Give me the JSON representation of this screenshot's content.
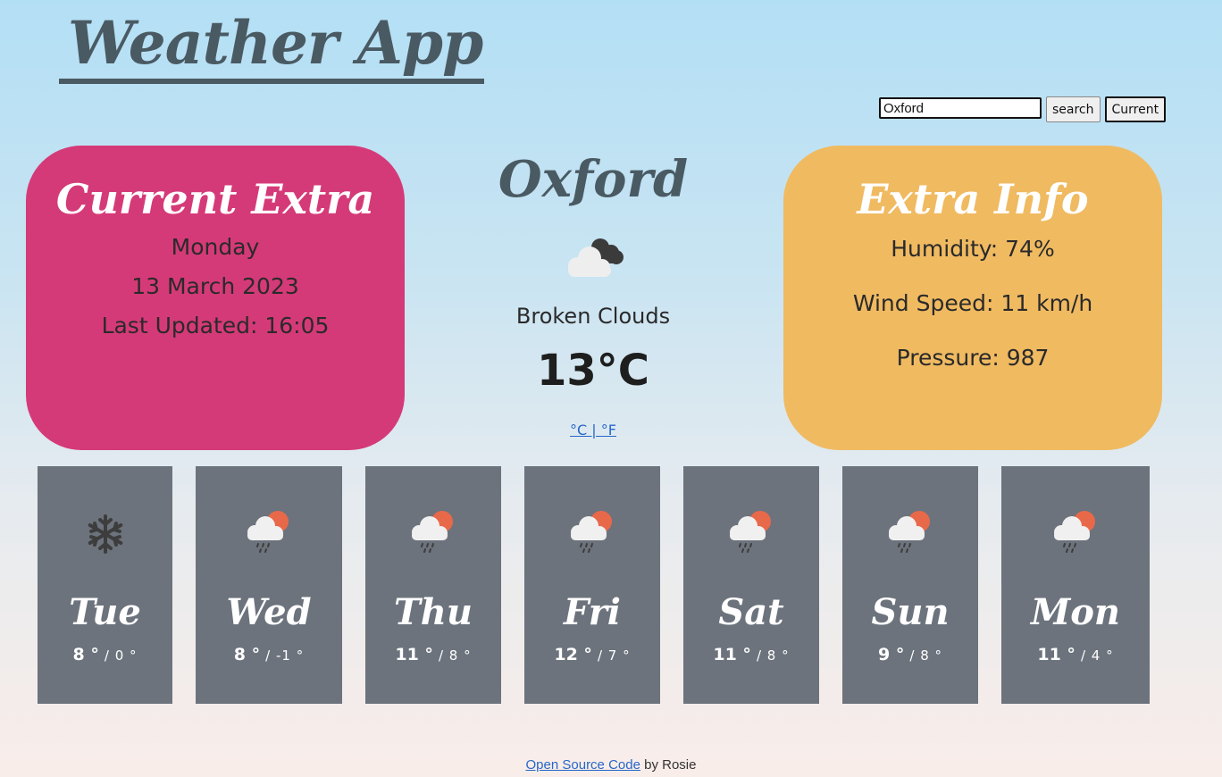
{
  "header": {
    "title": "Weather App"
  },
  "search": {
    "value": "Oxford",
    "button_label": "search",
    "current_label": "Current"
  },
  "current_extra": {
    "title": "Current Extra",
    "day": "Monday",
    "date": "13 March 2023",
    "last_updated": "Last Updated: 16:05"
  },
  "main": {
    "city": "Oxford",
    "icon": "broken-clouds-icon",
    "description": "Broken Clouds",
    "temperature": "13°C",
    "unit_toggle": "°C | °F"
  },
  "extra_info": {
    "title": "Extra Info",
    "humidity": "Humidity: 74%",
    "wind": "Wind Speed: 11 km/h",
    "pressure": "Pressure: 987"
  },
  "forecast": [
    {
      "day": "Tue",
      "high": "8 °",
      "low": "/ 0 °",
      "icon": "snowflake-icon"
    },
    {
      "day": "Wed",
      "high": "8 °",
      "low": "/ -1 °",
      "icon": "rain-sun-icon"
    },
    {
      "day": "Thu",
      "high": "11 °",
      "low": "/ 8 °",
      "icon": "rain-sun-icon"
    },
    {
      "day": "Fri",
      "high": "12 °",
      "low": "/ 7 °",
      "icon": "rain-sun-icon"
    },
    {
      "day": "Sat",
      "high": "11 °",
      "low": "/ 8 °",
      "icon": "rain-sun-icon"
    },
    {
      "day": "Sun",
      "high": "9 °",
      "low": "/ 8 °",
      "icon": "rain-sun-icon"
    },
    {
      "day": "Mon",
      "high": "11 °",
      "low": "/ 4 °",
      "icon": "rain-sun-icon"
    }
  ],
  "footer": {
    "link_text": "Open Source Code",
    "suffix": " by Rosie"
  },
  "colors": {
    "current_panel": "#d53a78",
    "extra_panel": "#f0ba61",
    "forecast_card": "#6c737c",
    "title": "#4a5a63"
  }
}
